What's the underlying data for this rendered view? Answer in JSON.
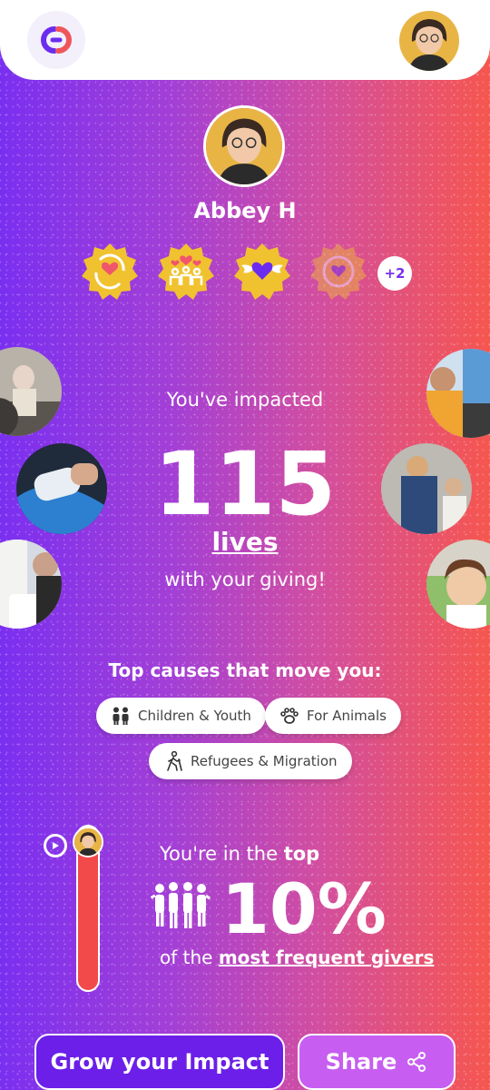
{
  "header": {
    "logo": "giving-app-logo",
    "avatar": "user-avatar"
  },
  "profile": {
    "name": "Abbey H",
    "badges_more": "+2",
    "badges": [
      {
        "icon": "recurring-heart-icon"
      },
      {
        "icon": "family-heart-icon"
      },
      {
        "icon": "winged-heart-icon"
      },
      {
        "icon": "heart-badge-locked-icon"
      }
    ]
  },
  "impact": {
    "line1": "You've impacted",
    "count": "115",
    "unit": "lives",
    "line3": "with your giving!"
  },
  "causes": {
    "title": "Top causes that move you:",
    "items": [
      {
        "label": "Children & Youth",
        "icon": "children-icon"
      },
      {
        "label": "For Animals",
        "icon": "paw-icon"
      },
      {
        "label": "Refugees & Migration",
        "icon": "walking-person-icon"
      }
    ]
  },
  "rank": {
    "prefix": "You're in the ",
    "emphasis": "top",
    "percent": "10%",
    "suffix_prefix": "of the ",
    "suffix_link": "most frequent givers",
    "meter_level": 0.95
  },
  "actions": {
    "grow": "Grow your Impact",
    "share": "Share"
  },
  "colors": {
    "accent": "#6b1fe8",
    "gradient_left": "#7a2ff0",
    "gradient_right": "#f6564f",
    "meter": "#f24a4a"
  }
}
